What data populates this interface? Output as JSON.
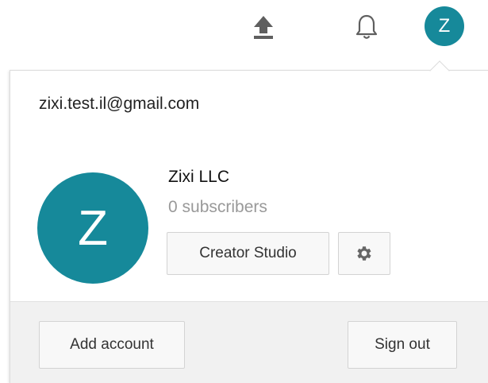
{
  "header": {
    "upload_icon": "upload-icon",
    "notifications_icon": "bell-icon",
    "avatar_letter": "Z"
  },
  "account": {
    "email": "zixi.test.il@gmail.com",
    "avatar_letter": "Z",
    "channel_name": "Zixi LLC",
    "subscribers": "0 subscribers"
  },
  "actions": {
    "creator_studio": "Creator Studio",
    "settings_icon": "gear-icon",
    "add_account": "Add account",
    "sign_out": "Sign out"
  },
  "colors": {
    "avatar_bg": "#16899a",
    "footer_bg": "#f1f1f1",
    "icon": "#606060"
  }
}
